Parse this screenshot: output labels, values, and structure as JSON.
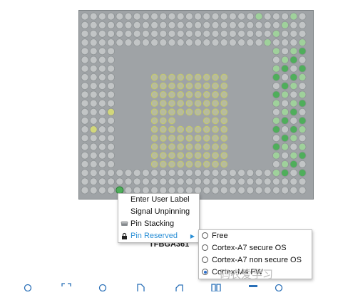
{
  "package": {
    "label": "TFBGA361"
  },
  "colors": {
    "board": "#9fa3a6",
    "pin": "#c2c5c6",
    "pin_green": "#4fae5b",
    "pin_light_green": "#9fd19b",
    "pin_yellow": "#d2d77a",
    "accent": "#2a8fd6"
  },
  "context_menu": {
    "items": [
      {
        "label": "Enter User Label",
        "icon": ""
      },
      {
        "label": "Signal Unpinning",
        "icon": ""
      },
      {
        "label": "Pin Stacking",
        "icon": "pin-stack-icon"
      },
      {
        "label": "Pin Reserved",
        "icon": "lock-icon",
        "active": true
      }
    ]
  },
  "submenu": {
    "options": [
      {
        "label": "Free",
        "selected": false
      },
      {
        "label": "Cortex-A7 secure OS",
        "selected": false
      },
      {
        "label": "Cortex-A7 non secure OS",
        "selected": false
      },
      {
        "label": "Cortex-M4 FW",
        "selected": true
      }
    ]
  },
  "watermark": "码农爱学习",
  "toolbar": [
    "zoom-in-icon",
    "fit-icon",
    "zoom-out-icon",
    "rotate-icon",
    "flip-icon",
    "split-icon",
    "grid-icon",
    "search-icon"
  ]
}
